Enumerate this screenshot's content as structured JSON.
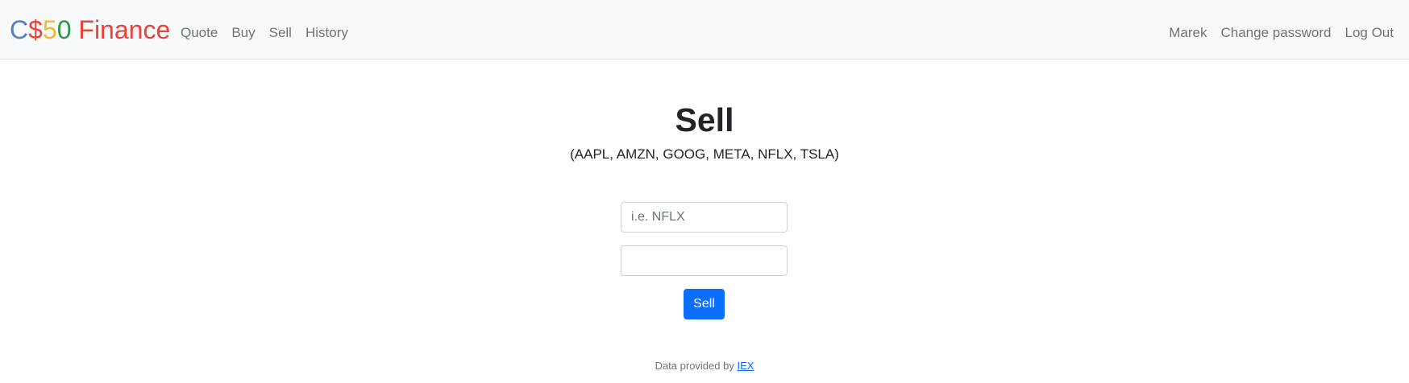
{
  "app": {
    "brand_parts": [
      {
        "text": "C",
        "color": "#537fbe"
      },
      {
        "text": "$",
        "color": "#ea433b"
      },
      {
        "text": "5",
        "color": "#f5b82e"
      },
      {
        "text": "0",
        "color": "#2e944b"
      },
      {
        "text": " Finance",
        "color": "#ea433b"
      }
    ]
  },
  "nav": {
    "left": [
      "Quote",
      "Buy",
      "Sell",
      "History"
    ],
    "right": [
      "Marek",
      "Change password",
      "Log Out"
    ]
  },
  "main": {
    "title": "Sell",
    "subtitle": "(AAPL, AMZN, GOOG, META, NFLX, TSLA)",
    "symbol_placeholder": "i.e. NFLX",
    "symbol_value": "",
    "shares_value": "",
    "sell_button_label": "Sell"
  },
  "footer": {
    "text": "Data provided by ",
    "link_text": "IEX"
  },
  "colors": {
    "primary": "#0d6efd",
    "navbar_bg": "#f8f9fa"
  }
}
